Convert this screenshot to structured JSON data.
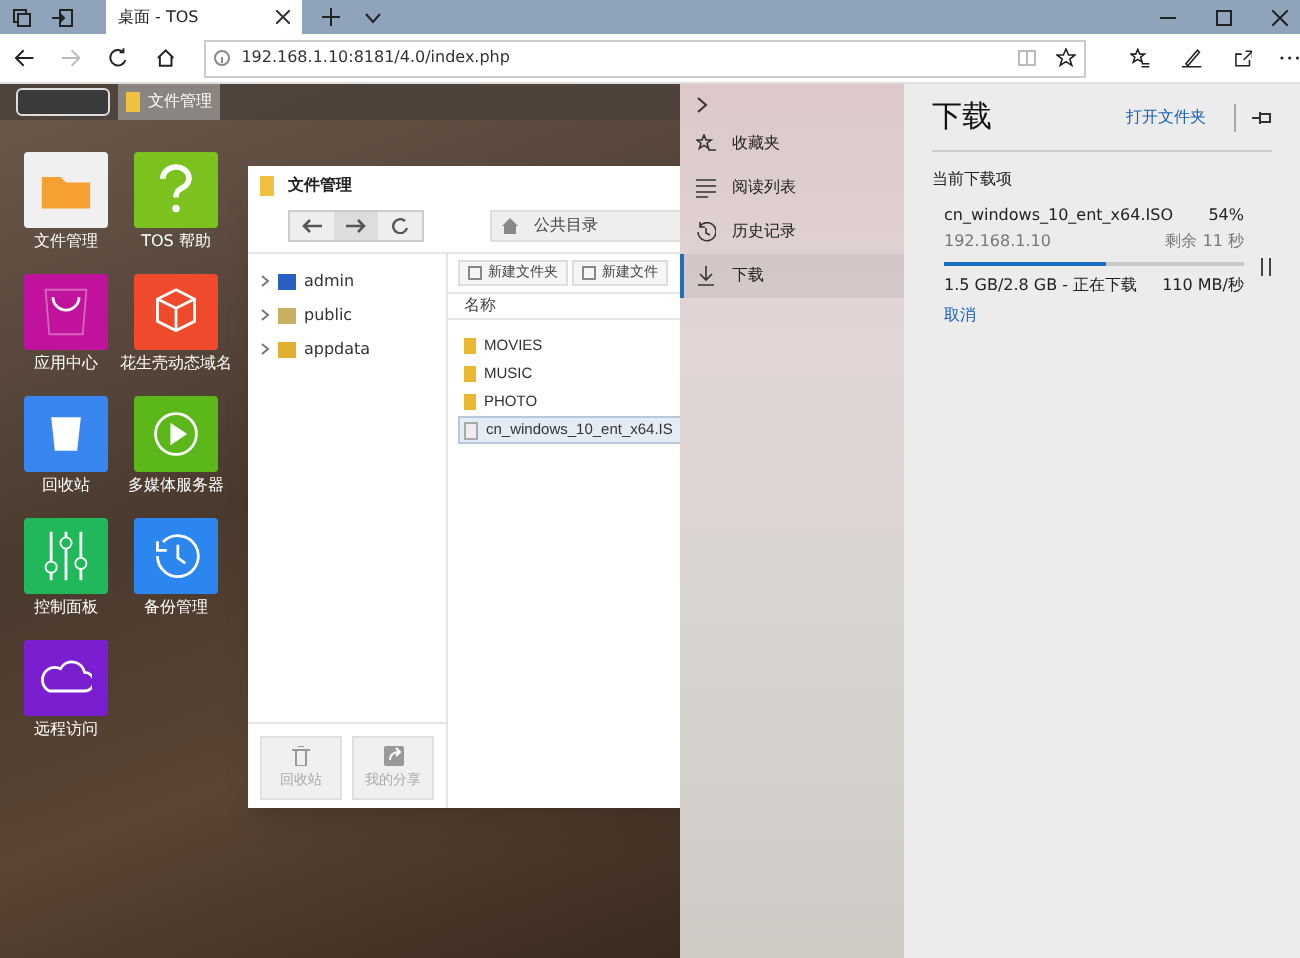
{
  "browser": {
    "tabs": [
      {
        "title": "桌面 - TOS",
        "selected": true
      }
    ],
    "address": "192.168.1.10:8181/4.0/index.php"
  },
  "desktop": {
    "taskbar_item": "文件管理",
    "apps": [
      {
        "label": "文件管理",
        "color": "#f0f0f0"
      },
      {
        "label": "TOS 帮助",
        "color": "#7cc21e"
      },
      {
        "label": "应用中心",
        "color": "#c0129c"
      },
      {
        "label": "花生壳动态域名",
        "color": "#f04a2c"
      },
      {
        "label": "回收站",
        "color": "#3a86f0"
      },
      {
        "label": "多媒体服务器",
        "color": "#5cb81a"
      },
      {
        "label": "控制面板",
        "color": "#20b85a"
      },
      {
        "label": "备份管理",
        "color": "#2b86f0"
      },
      {
        "label": "远程访问",
        "color": "#7a1fd0"
      }
    ]
  },
  "file_manager": {
    "title": "文件管理",
    "breadcrumb": "公共目录",
    "tree": [
      {
        "label": "admin"
      },
      {
        "label": "public"
      },
      {
        "label": "appdata"
      }
    ],
    "toolbar": [
      "新建文件夹",
      "新建文件"
    ],
    "column": "名称",
    "files": [
      {
        "name": "MOVIES",
        "kind": "folder",
        "selected": false
      },
      {
        "name": "MUSIC",
        "kind": "folder",
        "selected": false
      },
      {
        "name": "PHOTO",
        "kind": "folder",
        "selected": false
      },
      {
        "name": "cn_windows_10_ent_x64.IS",
        "kind": "file",
        "selected": true
      }
    ],
    "bottom_buttons": [
      "回收站",
      "我的分享"
    ]
  },
  "hub": {
    "nav": [
      {
        "label": "收藏夹",
        "selected": false
      },
      {
        "label": "阅读列表",
        "selected": false
      },
      {
        "label": "历史记录",
        "selected": false
      },
      {
        "label": "下载",
        "selected": true
      }
    ],
    "title": "下载",
    "open_folder": "打开文件夹",
    "section": "当前下载项",
    "download": {
      "filename": "cn_windows_10_ent_x64.ISO",
      "percent": "54%",
      "source": "192.168.1.10",
      "remaining": "剩余 11 秒",
      "level": 0.54,
      "size": "1.5 GB/2.8 GB - 正在下载",
      "speed": "110 MB/秒",
      "cancel": "取消"
    }
  }
}
